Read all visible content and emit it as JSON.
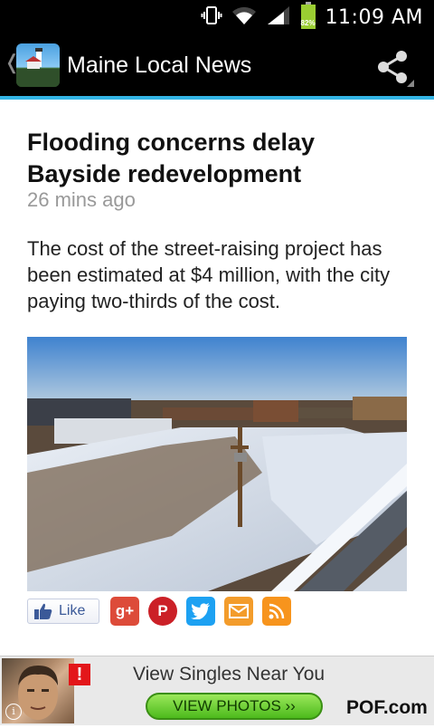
{
  "status_bar": {
    "time": "11:09 AM",
    "battery_level": "82%",
    "icons": [
      "vibrate-icon",
      "wifi-icon",
      "signal-icon",
      "battery-icon"
    ]
  },
  "action_bar": {
    "title": "Maine Local News",
    "icons": [
      "back-chevron-icon",
      "app-logo",
      "share-icon"
    ]
  },
  "article": {
    "headline": "Flooding concerns delay Bayside redevelopment",
    "timestamp": "26 mins ago",
    "summary": "The cost of the street-raising project has been estimated at $4 million, with the city paying two-thirds of the cost."
  },
  "social": {
    "like_label": "Like",
    "buttons": [
      "google-plus-icon",
      "pinterest-icon",
      "twitter-icon",
      "email-icon",
      "rss-icon"
    ]
  },
  "ad": {
    "headline": "View Singles Near You",
    "cta_label": "VIEW PHOTOS ››",
    "brand": "POF.com",
    "alert_mark": "!",
    "info_mark": "i"
  },
  "colors": {
    "accent": "#33b5e5",
    "battery": "#9acd32",
    "facebook": "#3b5998",
    "google_plus": "#dd4b39",
    "pinterest": "#cb2027",
    "twitter": "#1da1f2",
    "email": "#f39c2b",
    "rss": "#f7941d"
  }
}
